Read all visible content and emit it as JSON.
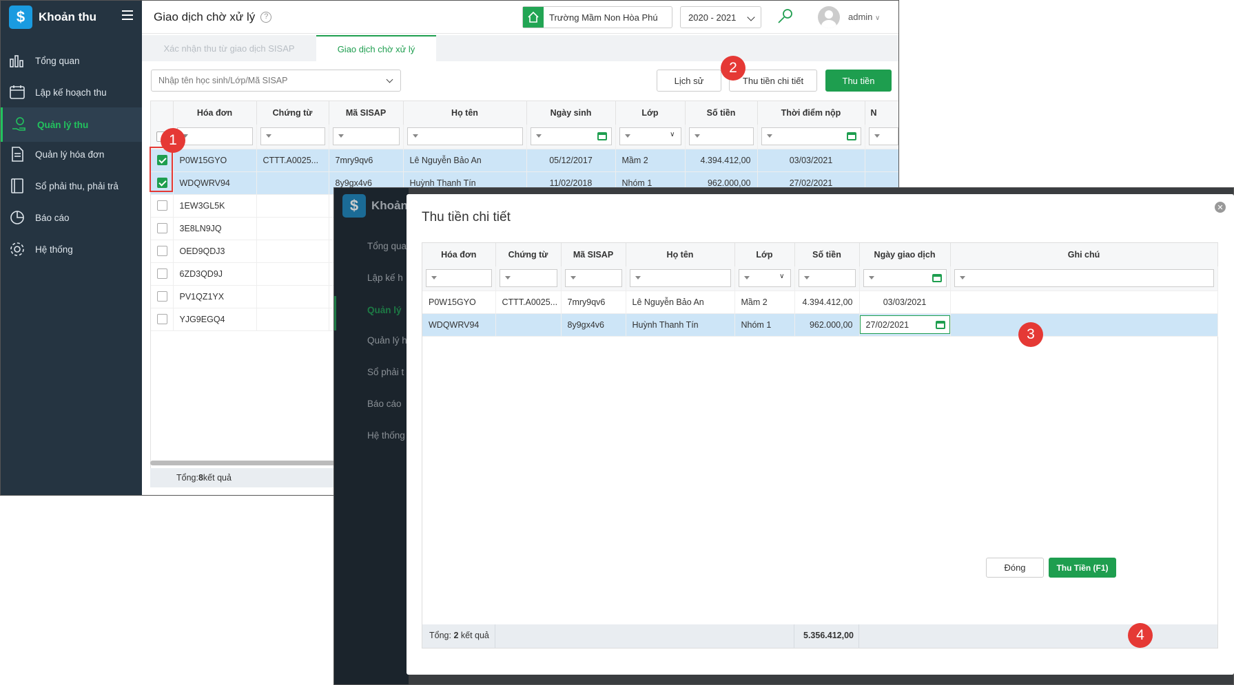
{
  "app": {
    "name": "Khoản thu"
  },
  "sidebar": {
    "items": [
      {
        "label": "Tổng quan",
        "icon": "chart-icon"
      },
      {
        "label": "Lập kế hoạch thu",
        "icon": "calendar-icon"
      },
      {
        "label": "Quản lý thu",
        "icon": "money-hand-icon"
      },
      {
        "label": "Quản lý hóa đơn",
        "icon": "document-icon"
      },
      {
        "label": "Sổ phải thu, phải trả",
        "icon": "ledger-icon"
      },
      {
        "label": "Báo cáo",
        "icon": "pie-chart-icon"
      },
      {
        "label": "Hệ thống",
        "icon": "gear-icon"
      }
    ]
  },
  "header": {
    "title": "Giao dịch chờ xử lý",
    "school": "Trường Mầm Non Hòa Phú",
    "year": "2020 - 2021",
    "user": "admin"
  },
  "tabs": [
    {
      "label": "Xác nhận thu từ giao dịch SISAP"
    },
    {
      "label": "Giao dịch chờ xử lý"
    }
  ],
  "search": {
    "placeholder": "Nhập tên học sinh/Lớp/Mã SISAP"
  },
  "buttons": {
    "history": "Lịch sử",
    "detail": "Thu tiền chi tiết",
    "collect": "Thu tiền"
  },
  "table": {
    "columns": [
      "Hóa đơn",
      "Chứng từ",
      "Mã SISAP",
      "Họ tên",
      "Ngày sinh",
      "Lớp",
      "Số tiền",
      "Thời điểm nộp",
      "N"
    ],
    "rows": [
      {
        "checked": true,
        "hd": "P0W15GYO",
        "ct": "CTTT.A0025...",
        "ma": "7mry9qv6",
        "ten": "Lê Nguyễn Bảo An",
        "ns": "05/12/2017",
        "lop": "Mầm 2",
        "tien": "4.394.412,00",
        "tg": "03/03/2021"
      },
      {
        "checked": true,
        "hd": "WDQWRV94",
        "ct": "",
        "ma": "8y9gx4v6",
        "ten": "Huỳnh Thanh Tín",
        "ns": "11/02/2018",
        "lop": "Nhóm 1",
        "tien": "962.000,00",
        "tg": "27/02/2021"
      },
      {
        "checked": false,
        "hd": "1EW3GL5K"
      },
      {
        "checked": false,
        "hd": "3E8LN9JQ"
      },
      {
        "checked": false,
        "hd": "OED9QDJ3"
      },
      {
        "checked": false,
        "hd": "6ZD3QD9J"
      },
      {
        "checked": false,
        "hd": "PV1QZ1YX"
      },
      {
        "checked": false,
        "hd": "YJG9EGQ4"
      }
    ],
    "footer": {
      "label": "Tổng: ",
      "count": "8",
      "suffix": " kết quả"
    }
  },
  "modal": {
    "title": "Thu tiền chi tiết",
    "columns": [
      "Hóa đơn",
      "Chứng từ",
      "Mã SISAP",
      "Họ tên",
      "Lớp",
      "Số tiền",
      "Ngày giao dịch",
      "Ghi chú"
    ],
    "rows": [
      {
        "hd": "P0W15GYO",
        "ct": "CTTT.A0025...",
        "ma": "7mry9qv6",
        "ten": "Lê Nguyễn Bảo An",
        "lop": "Mầm 2",
        "tien": "4.394.412,00",
        "ngay": "03/03/2021",
        "ghichu": ""
      },
      {
        "hd": "WDQWRV94",
        "ct": "",
        "ma": "8y9gx4v6",
        "ten": "Huỳnh Thanh Tín",
        "lop": "Nhóm 1",
        "tien": "962.000,00",
        "ngay": "27/02/2021",
        "ghichu": ""
      }
    ],
    "footer": {
      "label": "Tổng: ",
      "count": "2",
      "suffix": " kết quả",
      "total": "5.356.412,00"
    },
    "buttons": {
      "close": "Đóng",
      "collect": "Thu Tiền (F1)"
    }
  },
  "background_sidebar": {
    "brand": "Khoản",
    "items": [
      "Tổng qua",
      "Lập kế h",
      "Quản lý",
      "Quản lý h",
      "Sổ phải t",
      "Báo cáo",
      "Hệ thống"
    ]
  },
  "steps": [
    "1",
    "2",
    "3",
    "4"
  ],
  "colors": {
    "accent": "#1e9e4f",
    "sidebar": "#253441",
    "selected_row": "#cde5f7",
    "badge": "#e53935"
  }
}
